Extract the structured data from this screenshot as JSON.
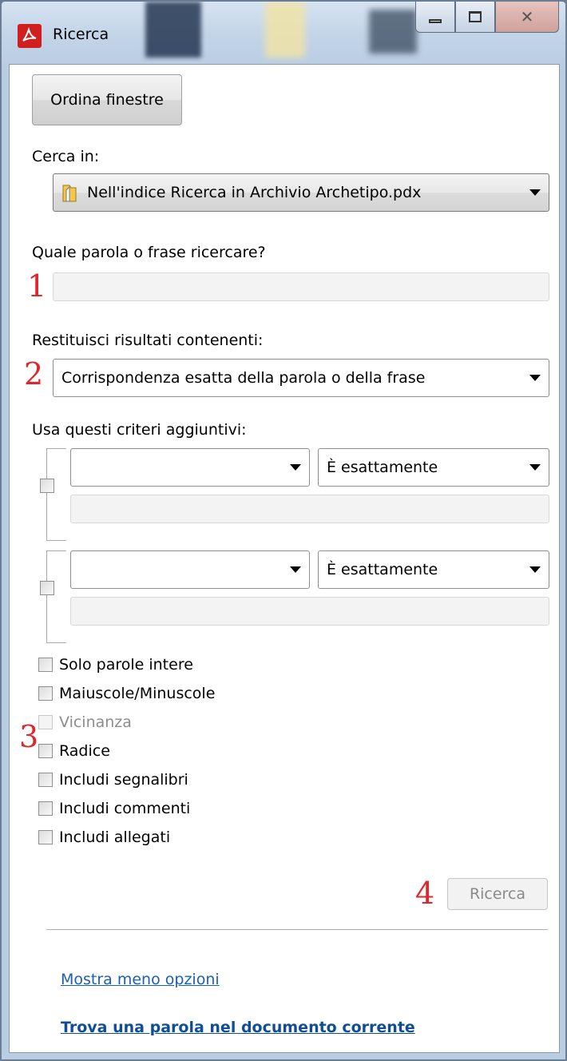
{
  "window": {
    "title": "Ricerca",
    "buttons": {
      "minimize": "minimize",
      "maximize": "maximize",
      "close": "close"
    }
  },
  "toolbar": {
    "arrange_label": "Ordina finestre"
  },
  "search_in": {
    "label": "Cerca in:",
    "value": "Nell'indice Ricerca in Archivio Archetipo.pdx"
  },
  "query": {
    "label": "Quale parola o frase ricercare?",
    "value": "",
    "marker": "1"
  },
  "return_results": {
    "label": "Restituisci risultati contenenti:",
    "value": "Corrispondenza esatta della parola o della frase",
    "marker": "2"
  },
  "criteria": {
    "label": "Usa questi criteri aggiuntivi:",
    "rows": [
      {
        "field": "",
        "operator": "È esattamente",
        "value": ""
      },
      {
        "field": "",
        "operator": "È esattamente",
        "value": ""
      }
    ]
  },
  "options": {
    "marker": "3",
    "items": [
      {
        "label": "Solo parole intere",
        "checked": false,
        "disabled": false
      },
      {
        "label": "Maiuscole/Minuscole",
        "checked": false,
        "disabled": false
      },
      {
        "label": "Vicinanza",
        "checked": false,
        "disabled": true
      },
      {
        "label": "Radice",
        "checked": false,
        "disabled": false
      },
      {
        "label": "Includi segnalibri",
        "checked": false,
        "disabled": false
      },
      {
        "label": "Includi commenti",
        "checked": false,
        "disabled": false
      },
      {
        "label": "Includi allegati",
        "checked": false,
        "disabled": false
      }
    ]
  },
  "search_button": {
    "label": "Ricerca",
    "marker": "4"
  },
  "links": {
    "fewer_options": "Mostra meno opzioni",
    "find_in_current": "Trova una parola nel documento corrente"
  },
  "colors": {
    "marker_red": "#e0262a",
    "link_blue": "#1a5fb4",
    "title_icon_red": "#d11e1e"
  }
}
